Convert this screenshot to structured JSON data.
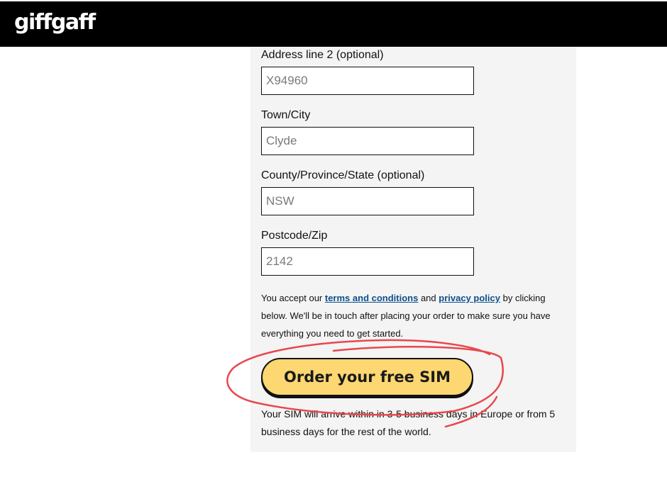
{
  "header": {
    "logo_text": "giffgaff"
  },
  "form": {
    "fields": [
      {
        "label": "Address line 2 (optional)",
        "placeholder": "X94960"
      },
      {
        "label": "Town/City",
        "placeholder": "Clyde"
      },
      {
        "label": "County/Province/State (optional)",
        "placeholder": "NSW"
      },
      {
        "label": "Postcode/Zip",
        "placeholder": "2142"
      }
    ],
    "terms": {
      "prefix": "You accept our ",
      "terms_link": "terms and conditions",
      "and": " and ",
      "privacy_link": "privacy policy",
      "suffix": " by clicking below. We'll be in touch after placing your order to make sure you have everything you need to get started."
    },
    "order_button_label": "Order your free SIM",
    "delivery_note": "Your SIM will arrive within in 3-5 business days in Europe or from 5 business days for the rest of the world."
  },
  "colors": {
    "header_bg": "#000000",
    "panel_bg": "#f4f4f4",
    "button_bg": "#fdd771",
    "link": "#0d4f8b",
    "annotation_circle": "#e8474c"
  }
}
